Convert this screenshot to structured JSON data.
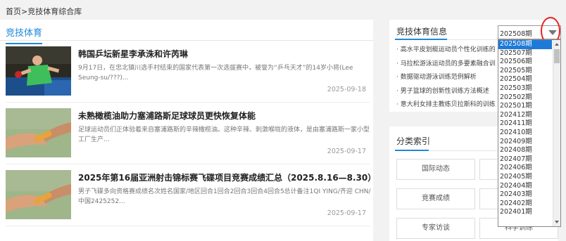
{
  "breadcrumb": "首页>竞技体育综合库",
  "left": {
    "title": "竞技体育",
    "articles": [
      {
        "title": "韩国乒坛新星李承洙和许芮琳",
        "desc": "9月17日，在忠北镇川选手村结束的国家代表第一次选拔赛中，被誉为“乒乓天才”的14岁小将(Lee Seung-su/???)...",
        "date": "2025-09-18"
      },
      {
        "title": "未熟橄榄油助力塞浦路斯足球球员更快恢复体能",
        "desc": "足球运动员们正体验着来自塞浦路斯的辛辣橄榄油。这种辛辣、刺激喉咙的液体，是由塞浦路斯一家小型工厂生产...",
        "date": "2025-09-17"
      },
      {
        "title": "2025年第16届亚洲射击锦标赛飞碟项目竞赛成绩汇总（2025.8.16—8.30）",
        "desc": "男子飞碟多向资格赛成绩名次姓名国家/地区回合1回合2回合3回合4回合5总计备注1QI YING/齐迎 CHN/中国2425252...",
        "date": "2025-09-17"
      }
    ]
  },
  "info": {
    "title": "竞技体育信息",
    "items": [
      "· 高水平皮划艇运动员个性化训练的",
      "· 马拉松游泳运动员的多要素融合训",
      "· 数据驱动游泳训练范例解析",
      "· 男子篮球的创新性训练方法概述",
      "· 意大利女排主教练贝拉斯科的训练"
    ]
  },
  "category": {
    "title": "分类索引",
    "buttons": [
      "国际动态",
      "",
      "竞赛成绩",
      "",
      "专家访谈",
      "科学训练"
    ]
  },
  "select": {
    "value": "202508期",
    "options": [
      "202508期",
      "202507期",
      "202506期",
      "202505期",
      "202504期",
      "202503期",
      "202502期",
      "202501期",
      "202412期",
      "202411期",
      "202410期",
      "202409期",
      "202408期",
      "202407期",
      "202406期",
      "202405期",
      "202404期",
      "202403期",
      "202402期",
      "202401期"
    ]
  },
  "colors": {
    "accent": "#1e88d8",
    "selected": "#1e7ad8",
    "highlight_circle": "#e82222"
  }
}
